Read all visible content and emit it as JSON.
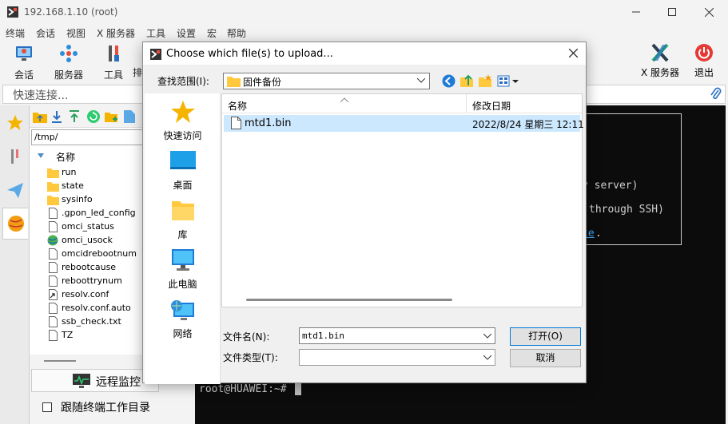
{
  "window": {
    "title": "192.168.1.10 (root)"
  },
  "menu": [
    "终端",
    "会话",
    "视图",
    "X 服务器",
    "工具",
    "设置",
    "宏",
    "帮助"
  ],
  "toolbar": {
    "items": [
      {
        "label": "会话",
        "icon": "session-icon"
      },
      {
        "label": "服务器",
        "icon": "servers-icon"
      },
      {
        "label": "工具",
        "icon": "tools-icon"
      },
      {
        "label": "排",
        "icon": "games-icon"
      }
    ],
    "right": [
      {
        "label": "X 服务器",
        "icon": "xserver-icon"
      },
      {
        "label": "退出",
        "icon": "power-icon"
      }
    ]
  },
  "quick_connect": {
    "placeholder": "快速连接..."
  },
  "file_panel": {
    "path": "/tmp/",
    "header": "名称",
    "files": [
      {
        "name": "run",
        "type": "folder"
      },
      {
        "name": "state",
        "type": "folder"
      },
      {
        "name": "sysinfo",
        "type": "folder"
      },
      {
        "name": ".gpon_led_config",
        "type": "file"
      },
      {
        "name": "omci_status",
        "type": "file"
      },
      {
        "name": "omci_usock",
        "type": "socket"
      },
      {
        "name": "omcidrebootnum",
        "type": "file"
      },
      {
        "name": "rebootcause",
        "type": "file"
      },
      {
        "name": "reboottrynum",
        "type": "file"
      },
      {
        "name": "resolv.conf",
        "type": "link"
      },
      {
        "name": "resolv.conf.auto",
        "type": "file"
      },
      {
        "name": "ssb_check.txt",
        "type": "file"
      },
      {
        "name": "TZ",
        "type": "file"
      }
    ],
    "monitor_label": "远程监控",
    "follow_label": "跟随终端工作目录"
  },
  "terminal": {
    "lines": [
      "y server)",
      "through SSH)",
      "te",
      "."
    ],
    "prompt": "root@HUAWEI:~#"
  },
  "dialog": {
    "title": "Choose which file(s) to upload...",
    "look_in_label": "查找范围(I):",
    "look_in_value": "固件备份",
    "places": [
      "快速访问",
      "桌面",
      "库",
      "此电脑",
      "网络"
    ],
    "columns": {
      "name": "名称",
      "modified": "修改日期"
    },
    "files": [
      {
        "name": "mtd1.bin",
        "date": "2022/8/24 星期三 12:11"
      }
    ],
    "filename_label": "文件名(N):",
    "filename_value": "mtd1.bin",
    "filetype_label": "文件类型(T):",
    "open_label": "打开(O)",
    "cancel_label": "取消"
  },
  "colors": {
    "accent": "#0078d7",
    "selection": "#cce8ff",
    "folder": "#ffc83d",
    "terminal_bg": "#0c0c0c"
  }
}
